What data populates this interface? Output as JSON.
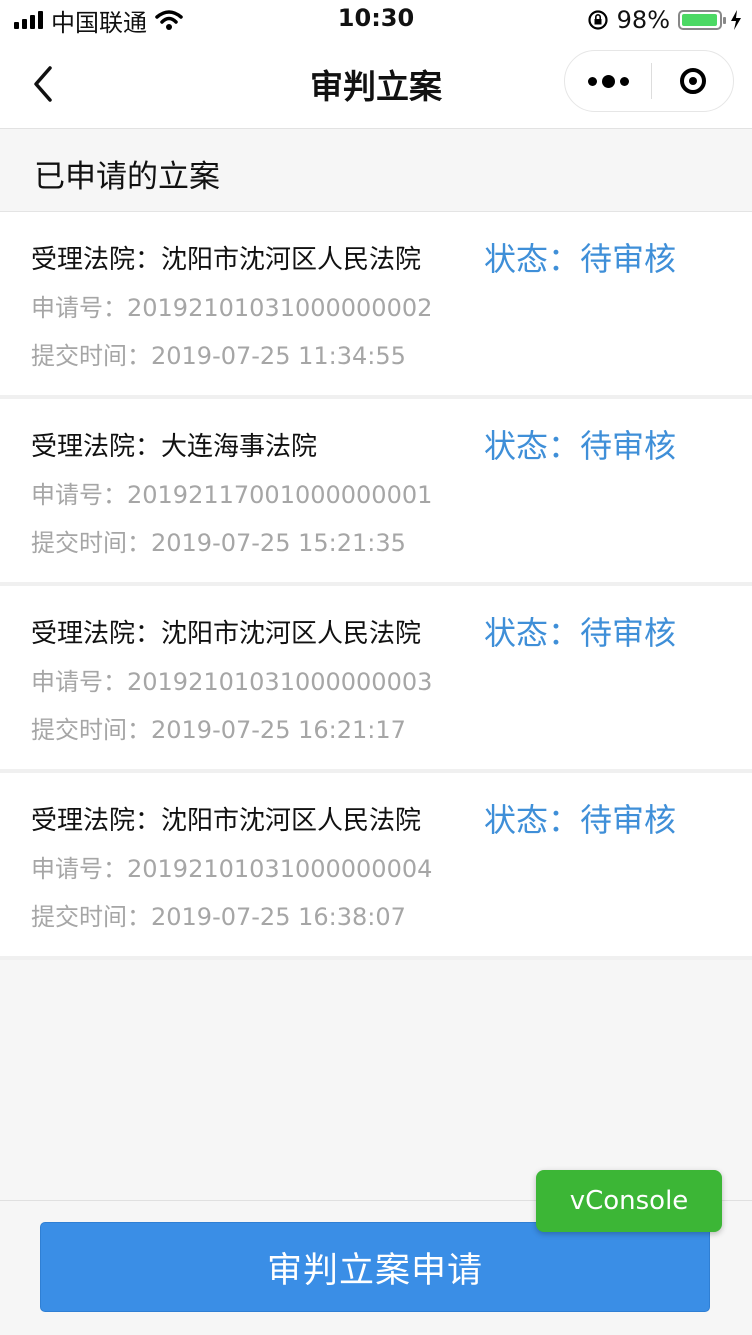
{
  "status_bar": {
    "carrier": "中国联通",
    "time": "10:30",
    "battery": "98%",
    "battery_level": 0.98
  },
  "nav": {
    "title": "审判立案"
  },
  "section": {
    "title": "已申请的立案"
  },
  "cases": [
    {
      "court": "受理法院：沈阳市沈河区人民法院",
      "status": "状态：待审核",
      "application_no": "申请号：20192101031000000002",
      "submit_time": "提交时间：2019-07-25 11:34:55"
    },
    {
      "court": "受理法院：大连海事法院",
      "status": "状态：待审核",
      "application_no": "申请号：20192117001000000001",
      "submit_time": "提交时间：2019-07-25 15:21:35"
    },
    {
      "court": "受理法院：沈阳市沈河区人民法院",
      "status": "状态：待审核",
      "application_no": "申请号：20192101031000000003",
      "submit_time": "提交时间：2019-07-25 16:21:17"
    },
    {
      "court": "受理法院：沈阳市沈河区人民法院",
      "status": "状态：待审核",
      "application_no": "申请号：20192101031000000004",
      "submit_time": "提交时间：2019-07-25 16:38:07"
    }
  ],
  "actions": {
    "submit_label": "审判立案申请",
    "vconsole_label": "vConsole"
  },
  "colors": {
    "status_text": "#3f8fd8",
    "primary_button": "#3a8ee6",
    "vconsole": "#3cb636",
    "muted_text": "#a6a6a6"
  },
  "icons": [
    "signal-icon",
    "wifi-icon",
    "rotation-lock-icon",
    "battery-icon",
    "charging-icon",
    "back-arrow-icon",
    "more-dots-icon",
    "close-target-icon"
  ]
}
